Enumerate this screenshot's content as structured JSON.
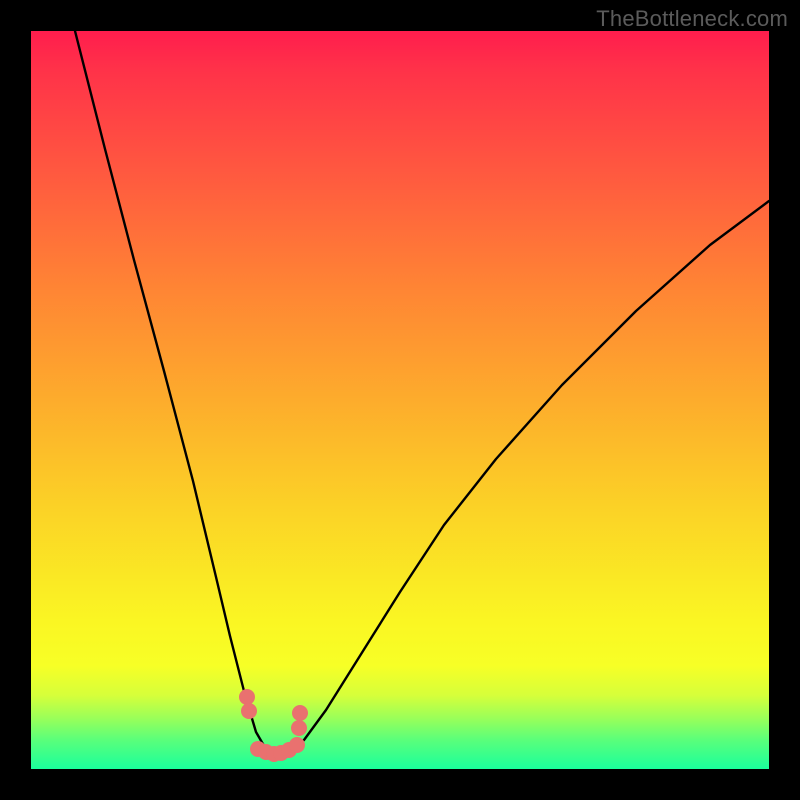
{
  "watermark": "TheBottleneck.com",
  "chart_data": {
    "type": "line",
    "title": "",
    "xlabel": "",
    "ylabel": "",
    "xlim": [
      0,
      100
    ],
    "ylim": [
      0,
      100
    ],
    "series": [
      {
        "name": "bottleneck-curve",
        "x": [
          6,
          10,
          14,
          18,
          22,
          25,
          27,
          29,
          30.5,
          32,
          33.5,
          35,
          37,
          40,
          45,
          50,
          56,
          63,
          72,
          82,
          92,
          100
        ],
        "values": [
          100,
          84,
          69,
          54,
          39,
          26,
          18,
          10,
          5,
          2.5,
          2,
          2.5,
          4,
          8,
          16,
          24,
          33,
          42,
          52,
          62,
          71,
          77
        ]
      }
    ],
    "markers": {
      "name": "highlight-dots",
      "x": [
        29.3,
        29.5,
        30.8,
        31.8,
        32.9,
        33.9,
        35.0,
        36.0,
        36.3,
        36.5
      ],
      "values": [
        9.8,
        7.8,
        2.7,
        2.3,
        2.1,
        2.2,
        2.6,
        3.3,
        5.5,
        7.6
      ]
    },
    "green_band": {
      "from": 0,
      "to": 4
    },
    "colors": {
      "background_top": "#ff1d4d",
      "background_mid1": "#ff8534",
      "background_mid2": "#fbd326",
      "background_bottom": "#1aff9c",
      "curve": "#000000",
      "dots": "#e9716f",
      "frame": "#000000"
    }
  }
}
